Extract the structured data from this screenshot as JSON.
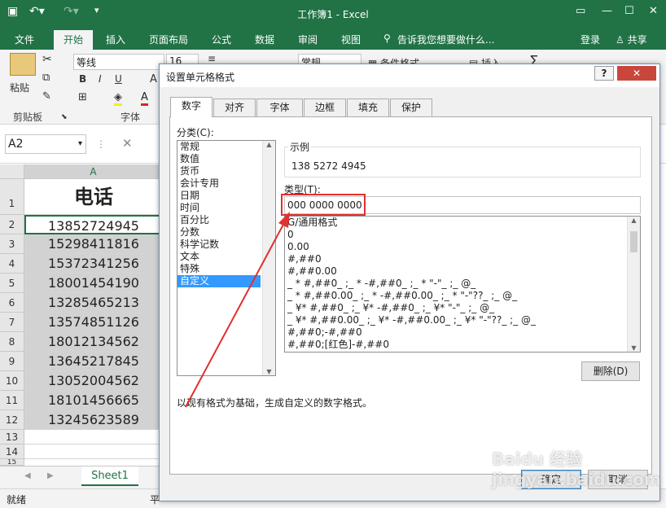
{
  "excel": {
    "window_title": "工作簿1 - Excel",
    "ribbon_tabs": [
      "文件",
      "开始",
      "插入",
      "页面布局",
      "公式",
      "数据",
      "审阅",
      "视图"
    ],
    "tell_me": "告诉我您想要做什么...",
    "login": "登录",
    "share": "共享",
    "font_name": "等线",
    "font_size": "16",
    "paste_label": "粘贴",
    "bold": "B",
    "italic": "I",
    "underline": "U",
    "font_color_a": "A",
    "number_format": "常规",
    "conditional_format": "条件格式",
    "insert_cells": "插入",
    "group_clipboard": "剪贴板",
    "group_font": "字体",
    "name_box": "A2",
    "column_a": "A",
    "header_cell": "电话",
    "rows": [
      {
        "num": "1",
        "value": "电话"
      },
      {
        "num": "2",
        "value": "13852724945"
      },
      {
        "num": "3",
        "value": "15298411816"
      },
      {
        "num": "4",
        "value": "15372341256"
      },
      {
        "num": "5",
        "value": "18001454190"
      },
      {
        "num": "6",
        "value": "13285465213"
      },
      {
        "num": "7",
        "value": "13574851126"
      },
      {
        "num": "8",
        "value": "18012134562"
      },
      {
        "num": "9",
        "value": "13645217845"
      },
      {
        "num": "10",
        "value": "13052004562"
      },
      {
        "num": "11",
        "value": "18101456665"
      },
      {
        "num": "12",
        "value": "13245623589"
      },
      {
        "num": "13",
        "value": ""
      },
      {
        "num": "14",
        "value": ""
      },
      {
        "num": "15",
        "value": ""
      }
    ],
    "sheet_tab": "Sheet1",
    "status": "就绪",
    "status_partial": "平"
  },
  "dialog": {
    "title": "设置单元格格式",
    "help": "?",
    "close": "✕",
    "tabs": [
      "数字",
      "对齐",
      "字体",
      "边框",
      "填充",
      "保护"
    ],
    "category_label": "分类(C):",
    "categories": [
      "常规",
      "数值",
      "货币",
      "会计专用",
      "日期",
      "时间",
      "百分比",
      "分数",
      "科学记数",
      "文本",
      "特殊",
      "自定义"
    ],
    "selected_category": "自定义",
    "sample_label": "示例",
    "sample_value": "138 5272 4945",
    "type_label": "类型(T):",
    "type_value": "000 0000 0000",
    "formats": [
      "G/通用格式",
      "0",
      "0.00",
      "#,##0",
      "#,##0.00",
      "_ * #,##0_ ;_ * -#,##0_ ;_ * \"-\"_ ;_ @_",
      "_ * #,##0.00_ ;_ * -#,##0.00_ ;_ * \"-\"??_ ;_ @_",
      "_ ¥* #,##0_ ;_ ¥* -#,##0_ ;_ ¥* \"-\"_ ;_ @_",
      "_ ¥* #,##0.00_ ;_ ¥* -#,##0.00_ ;_ ¥* \"-\"??_ ;_ @_",
      "#,##0;-#,##0",
      "#,##0;[红色]-#,##0"
    ],
    "delete_button": "删除(D)",
    "description": "以现有格式为基础，生成自定义的数字格式。",
    "ok_button": "确定",
    "cancel_button": "取消"
  },
  "watermark": "Baidu 经验 jingyan.baidu.com",
  "colors": {
    "excel_green": "#217346",
    "highlight": "#e03030",
    "selection": "#3399ff"
  }
}
